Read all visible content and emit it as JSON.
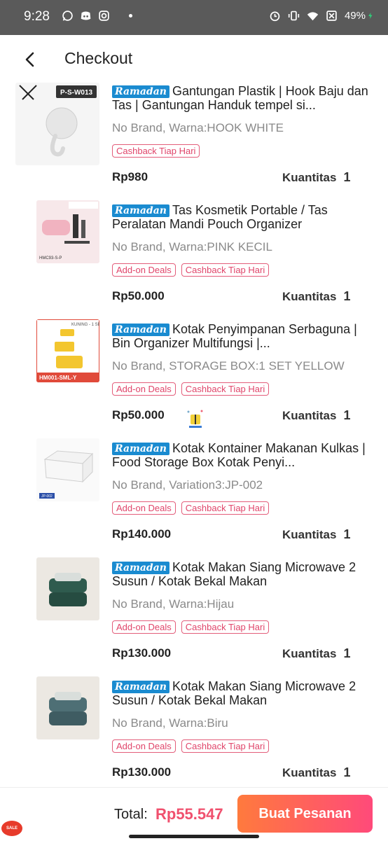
{
  "status": {
    "time": "9:28",
    "battery": "49%"
  },
  "header": {
    "title": "Checkout"
  },
  "badge_label": "Ramadan",
  "qty_label": "Kuantitas",
  "items": [
    {
      "title": "Gantungan Plastik | Hook Baju dan Tas | Gantungan Handuk tempel si...",
      "variant": "No Brand, Warna:HOOK WHITE",
      "tags": [
        "Cashback Tiap Hari"
      ],
      "price": "Rp980",
      "qty": "1",
      "thumb_text": "P-S-W013"
    },
    {
      "title": "Tas Kosmetik Portable / Tas Peralatan Mandi Pouch Organizer",
      "variant": "No Brand, Warna:PINK KECIL",
      "tags": [
        "Add-on Deals",
        "Cashback Tiap Hari"
      ],
      "price": "Rp50.000",
      "qty": "1",
      "thumb_text": "HMC93-S-P"
    },
    {
      "title": "Kotak Penyimpanan Serbaguna | Bin Organizer Multifungsi |...",
      "variant": "No Brand, STORAGE BOX:1 SET YELLOW",
      "tags": [
        "Add-on Deals",
        "Cashback Tiap Hari"
      ],
      "price": "Rp50.000",
      "qty": "1",
      "thumb_text": "HM001-SML-Y"
    },
    {
      "title": "Kotak Kontainer Makanan Kulkas | Food Storage Box Kotak Penyi...",
      "variant": "No Brand, Variation3:JP-002",
      "tags": [
        "Add-on Deals",
        "Cashback Tiap Hari"
      ],
      "price": "Rp140.000",
      "qty": "1",
      "thumb_text": "JP-002"
    },
    {
      "title": "Kotak Makan Siang Microwave 2 Susun / Kotak Bekal Makan",
      "variant": "No Brand, Warna:Hijau",
      "tags": [
        "Add-on Deals",
        "Cashback Tiap Hari"
      ],
      "price": "Rp130.000",
      "qty": "1",
      "thumb_text": ""
    },
    {
      "title": "Kotak Makan Siang Microwave 2 Susun / Kotak Bekal Makan",
      "variant": "No Brand, Warna:Biru",
      "tags": [
        "Add-on Deals",
        "Cashback Tiap Hari"
      ],
      "price": "Rp130.000",
      "qty": "1",
      "thumb_text": ""
    }
  ],
  "footer": {
    "total_label": "Total:",
    "total_value": "Rp55.547",
    "button_label": "Buat Pesanan"
  },
  "colors": {
    "accent": "#f0506e",
    "button_start": "#ff7a3d",
    "button_end": "#ff4a7a",
    "badge": "#1a8bd0",
    "tag_border": "#e35d7a"
  }
}
